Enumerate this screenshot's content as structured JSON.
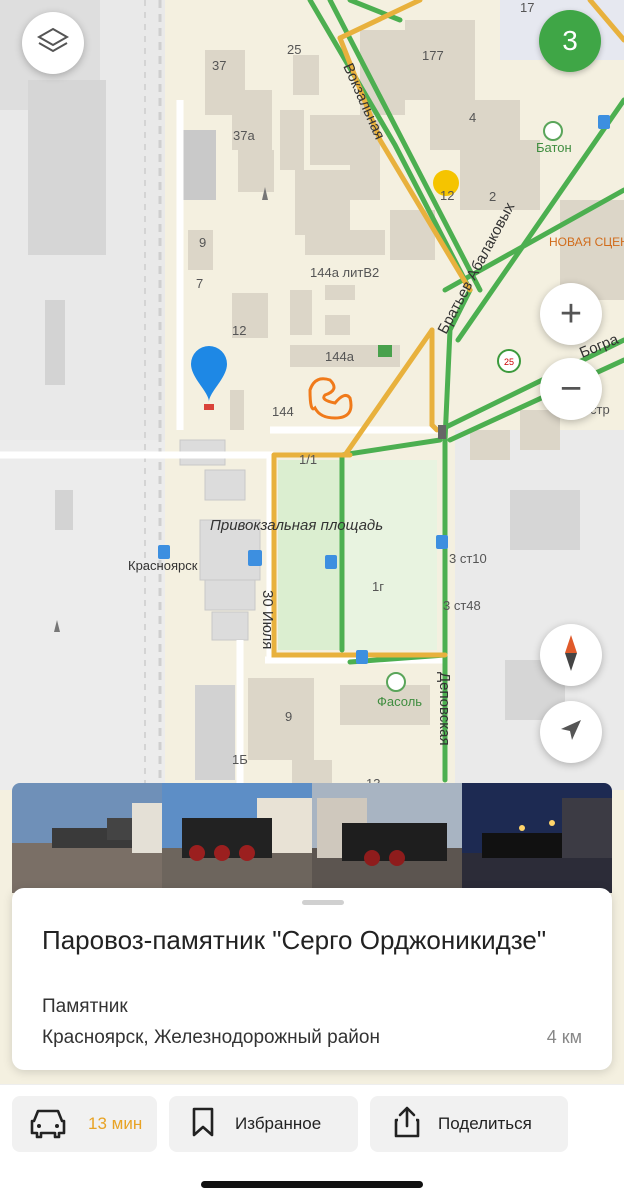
{
  "map": {
    "layers_icon": "layers-icon",
    "cluster_count": "3",
    "labels": {
      "vokzalnaya": "Вокзальная",
      "bratyev": "Братьев Абалаковых",
      "deporovskaya": "Деповская",
      "iyulya": "30 Июля",
      "square": "Привокзальная площадь",
      "krasnoyarsk": "Красноярск",
      "baton": "Батон",
      "novaya_scena": "НОВАЯ СЦЕН",
      "fasol": "Фасоль",
      "bogr": "Богра",
      "house_17": "17",
      "house_25": "25",
      "house_37": "37",
      "house_37a": "37а",
      "house_177": "177",
      "house_4": "4",
      "house_2": "2",
      "house_12a": "12",
      "house_9": "9",
      "house_7": "7",
      "house_12": "12",
      "house_144a_litv2": "144а литВ2",
      "house_144a": "144а",
      "house_144": "144",
      "house_1_1": "1/1",
      "house_3st10": "3 ст10",
      "house_1g": "1г",
      "house_3st48": "3 ст48",
      "house_9b": "9",
      "house_1b": "1Б",
      "house_13": "13",
      "house_str": "стр",
      "route_25": "25"
    }
  },
  "controls": {
    "zoom_in": "+",
    "zoom_out": "−",
    "compass_icon": "compass-icon",
    "locate_icon": "navigation-arrow-icon"
  },
  "place": {
    "title": "Паровоз-памятник \"Серго Орджоникидзе\"",
    "kind": "Памятник",
    "address": "Красноярск, Железнодорожный район",
    "distance": "4 км"
  },
  "actions": {
    "route": {
      "icon": "car-icon",
      "label": "13 мин"
    },
    "favorite": {
      "icon": "bookmark-icon",
      "label": "Избранное"
    },
    "share": {
      "icon": "share-icon",
      "label": "Поделиться"
    }
  },
  "colors": {
    "accent_time": "#e8a325",
    "badge_green": "#3fa646",
    "road_green": "#4caf50",
    "road_yellow": "#e8b13d",
    "marker_blue": "#1e88e5"
  }
}
